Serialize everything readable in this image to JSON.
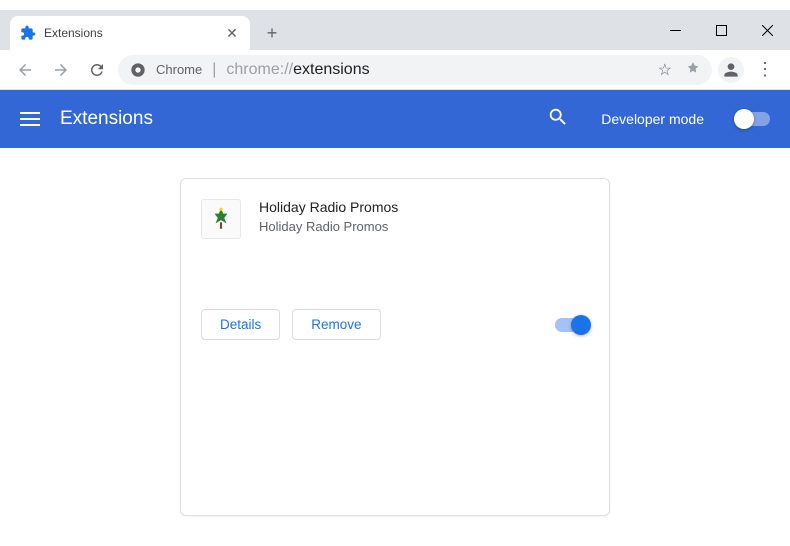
{
  "window": {
    "tab_title": "Extensions",
    "url_prefix": "chrome://",
    "url_path": "extensions",
    "address_label": "Chrome"
  },
  "header": {
    "title": "Extensions",
    "dev_mode_label": "Developer mode"
  },
  "extension": {
    "name": "Holiday Radio Promos",
    "description": "Holiday Radio Promos",
    "details_label": "Details",
    "remove_label": "Remove",
    "enabled": true
  },
  "colors": {
    "primary_blue": "#3367d6",
    "accent_blue": "#1a73e8"
  }
}
